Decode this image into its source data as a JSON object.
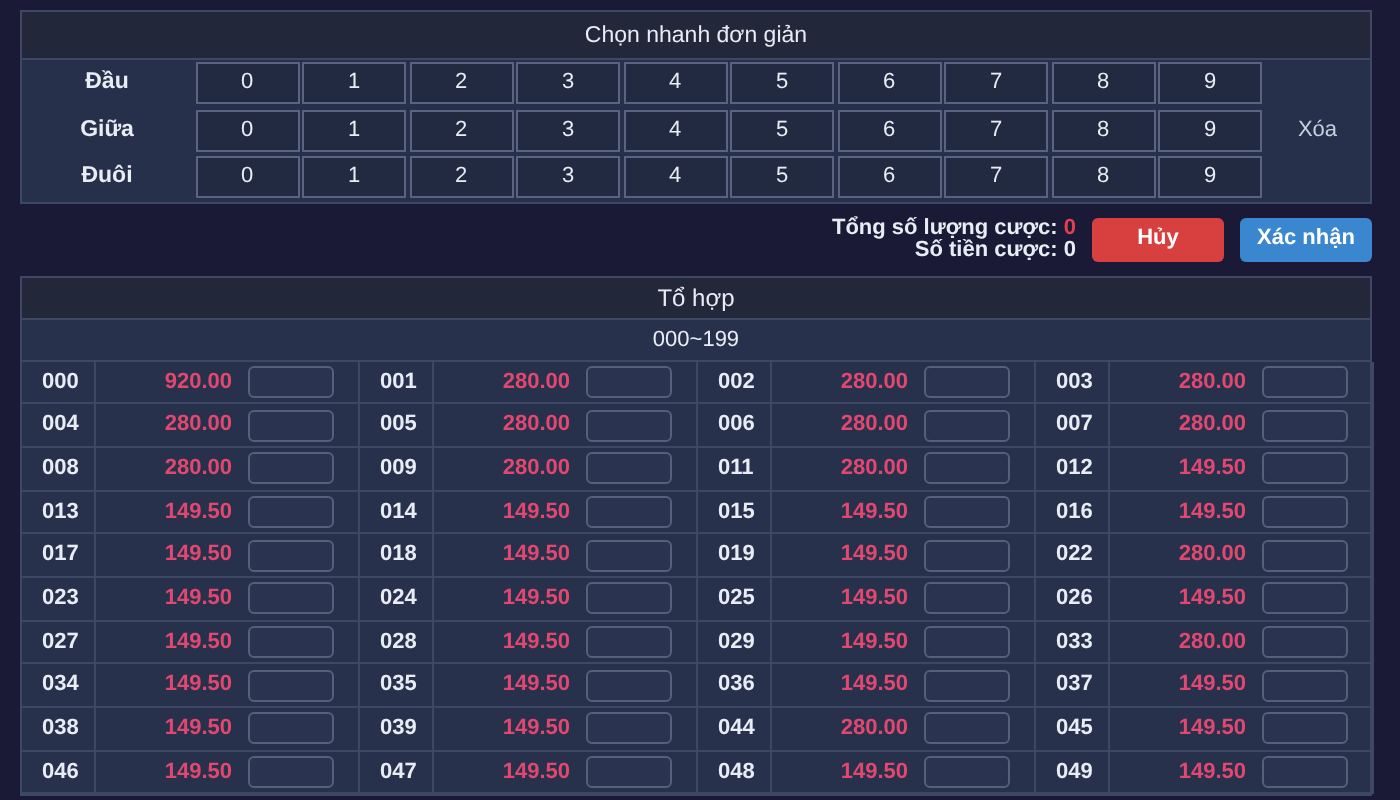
{
  "quick_pick": {
    "title": "Chọn nhanh đơn giản",
    "rows": [
      {
        "label": "Đầu",
        "digits": [
          "0",
          "1",
          "2",
          "3",
          "4",
          "5",
          "6",
          "7",
          "8",
          "9"
        ]
      },
      {
        "label": "Giữa",
        "digits": [
          "0",
          "1",
          "2",
          "3",
          "4",
          "5",
          "6",
          "7",
          "8",
          "9"
        ],
        "action": "Xóa"
      },
      {
        "label": "Đuôi",
        "digits": [
          "0",
          "1",
          "2",
          "3",
          "4",
          "5",
          "6",
          "7",
          "8",
          "9"
        ]
      }
    ]
  },
  "totals": {
    "count_label": "Tổng số lượng cược:",
    "count": "0",
    "amount_label": "Số tiền cược:",
    "amount": "0"
  },
  "buttons": [
    {
      "label": "Hủy",
      "kind": "cancel"
    },
    {
      "label": "Xác nhận",
      "kind": "confirm"
    }
  ],
  "combos": {
    "title": "Tổ hợp",
    "range": "000~199",
    "entries": [
      {
        "code": "000",
        "odds": "920.00"
      },
      {
        "code": "001",
        "odds": "280.00"
      },
      {
        "code": "002",
        "odds": "280.00"
      },
      {
        "code": "003",
        "odds": "280.00"
      },
      {
        "code": "004",
        "odds": "280.00"
      },
      {
        "code": "005",
        "odds": "280.00"
      },
      {
        "code": "006",
        "odds": "280.00"
      },
      {
        "code": "007",
        "odds": "280.00"
      },
      {
        "code": "008",
        "odds": "280.00"
      },
      {
        "code": "009",
        "odds": "280.00"
      },
      {
        "code": "011",
        "odds": "280.00"
      },
      {
        "code": "012",
        "odds": "149.50"
      },
      {
        "code": "013",
        "odds": "149.50"
      },
      {
        "code": "014",
        "odds": "149.50"
      },
      {
        "code": "015",
        "odds": "149.50"
      },
      {
        "code": "016",
        "odds": "149.50"
      },
      {
        "code": "017",
        "odds": "149.50"
      },
      {
        "code": "018",
        "odds": "149.50"
      },
      {
        "code": "019",
        "odds": "149.50"
      },
      {
        "code": "022",
        "odds": "280.00"
      },
      {
        "code": "023",
        "odds": "149.50"
      },
      {
        "code": "024",
        "odds": "149.50"
      },
      {
        "code": "025",
        "odds": "149.50"
      },
      {
        "code": "026",
        "odds": "149.50"
      },
      {
        "code": "027",
        "odds": "149.50"
      },
      {
        "code": "028",
        "odds": "149.50"
      },
      {
        "code": "029",
        "odds": "149.50"
      },
      {
        "code": "033",
        "odds": "280.00"
      },
      {
        "code": "034",
        "odds": "149.50"
      },
      {
        "code": "035",
        "odds": "149.50"
      },
      {
        "code": "036",
        "odds": "149.50"
      },
      {
        "code": "037",
        "odds": "149.50"
      },
      {
        "code": "038",
        "odds": "149.50"
      },
      {
        "code": "039",
        "odds": "149.50"
      },
      {
        "code": "044",
        "odds": "280.00"
      },
      {
        "code": "045",
        "odds": "149.50"
      },
      {
        "code": "046",
        "odds": "149.50"
      },
      {
        "code": "047",
        "odds": "149.50"
      },
      {
        "code": "048",
        "odds": "149.50"
      },
      {
        "code": "049",
        "odds": "149.50"
      }
    ]
  }
}
